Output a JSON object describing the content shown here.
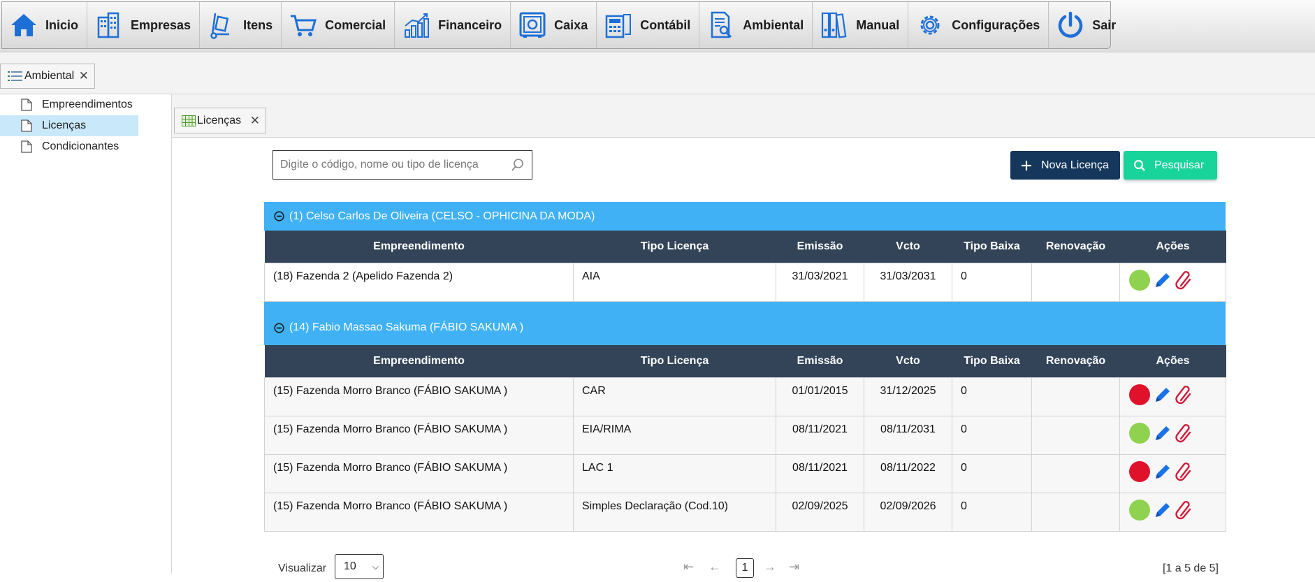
{
  "menu": {
    "items": [
      {
        "label": "Inicio",
        "icon": "home-icon"
      },
      {
        "label": "Empresas",
        "icon": "buildings-icon"
      },
      {
        "label": "Itens",
        "icon": "hand-truck-icon"
      },
      {
        "label": "Comercial",
        "icon": "cart-icon"
      },
      {
        "label": "Financeiro",
        "icon": "growth-chart-icon"
      },
      {
        "label": "Caixa",
        "icon": "safe-icon"
      },
      {
        "label": "Contábil",
        "icon": "calculator-icon"
      },
      {
        "label": "Ambiental",
        "icon": "report-search-icon"
      },
      {
        "label": "Manual",
        "icon": "binders-icon"
      },
      {
        "label": "Configurações",
        "icon": "gear-icon"
      },
      {
        "label": "Sair",
        "icon": "power-icon"
      }
    ]
  },
  "outer_tab": {
    "label": "Ambiental",
    "icon": "list-icon",
    "close": "✕"
  },
  "sidebar": {
    "items": [
      {
        "label": "Empreendimentos",
        "active": false
      },
      {
        "label": "Licenças",
        "active": true
      },
      {
        "label": "Condicionantes",
        "active": false
      }
    ]
  },
  "inner_tab": {
    "label": "Licenças",
    "icon": "grid-icon",
    "close": "✕"
  },
  "search": {
    "placeholder": "Digite o código, nome ou tipo de licença",
    "value": ""
  },
  "buttons": {
    "new": "Nova Licença",
    "search": "Pesquisar"
  },
  "colors": {
    "group_header": "#3fb1f4",
    "table_header": "#334459",
    "status_ok": "#8fd24f",
    "status_expired": "#e0112b",
    "edit": "#1a73e8",
    "attach": "#d11a3a"
  },
  "columns": [
    "Empreendimento",
    "Tipo Licença",
    "Emissão",
    "Vcto",
    "Tipo Baixa",
    "Renovação",
    "Ações"
  ],
  "groups": [
    {
      "title": "(1) Celso Carlos De Oliveira (CELSO - OPHICINA DA MODA)",
      "rows": [
        {
          "empreendimento": "(18) Fazenda 2 (Apelido Fazenda 2)",
          "tipo": "AIA",
          "emissao": "31/03/2021",
          "vcto": "31/03/2031",
          "baixa": "0",
          "renovacao": "",
          "status": "ok"
        }
      ]
    },
    {
      "title": "(14) Fabio Massao Sakuma (FÁBIO SAKUMA )",
      "rows": [
        {
          "empreendimento": "(15) Fazenda Morro Branco (FÁBIO SAKUMA )",
          "tipo": "CAR",
          "emissao": "01/01/2015",
          "vcto": "31/12/2025",
          "baixa": "0",
          "renovacao": "",
          "status": "expired"
        },
        {
          "empreendimento": "(15) Fazenda Morro Branco (FÁBIO SAKUMA )",
          "tipo": "EIA/RIMA",
          "emissao": "08/11/2021",
          "vcto": "08/11/2031",
          "baixa": "0",
          "renovacao": "",
          "status": "ok"
        },
        {
          "empreendimento": "(15) Fazenda Morro Branco (FÁBIO SAKUMA )",
          "tipo": "LAC 1",
          "emissao": "08/11/2021",
          "vcto": "08/11/2022",
          "baixa": "0",
          "renovacao": "",
          "status": "expired"
        },
        {
          "empreendimento": "(15) Fazenda Morro Branco (FÁBIO SAKUMA )",
          "tipo": "Simples Declaração (Cod.10)",
          "emissao": "02/09/2025",
          "vcto": "02/09/2026",
          "baixa": "0",
          "renovacao": "",
          "status": "ok"
        }
      ]
    }
  ],
  "pagination": {
    "label": "Visualizar",
    "page_size": "10",
    "current_page": "1",
    "info": "[1 a 5 de 5]"
  }
}
